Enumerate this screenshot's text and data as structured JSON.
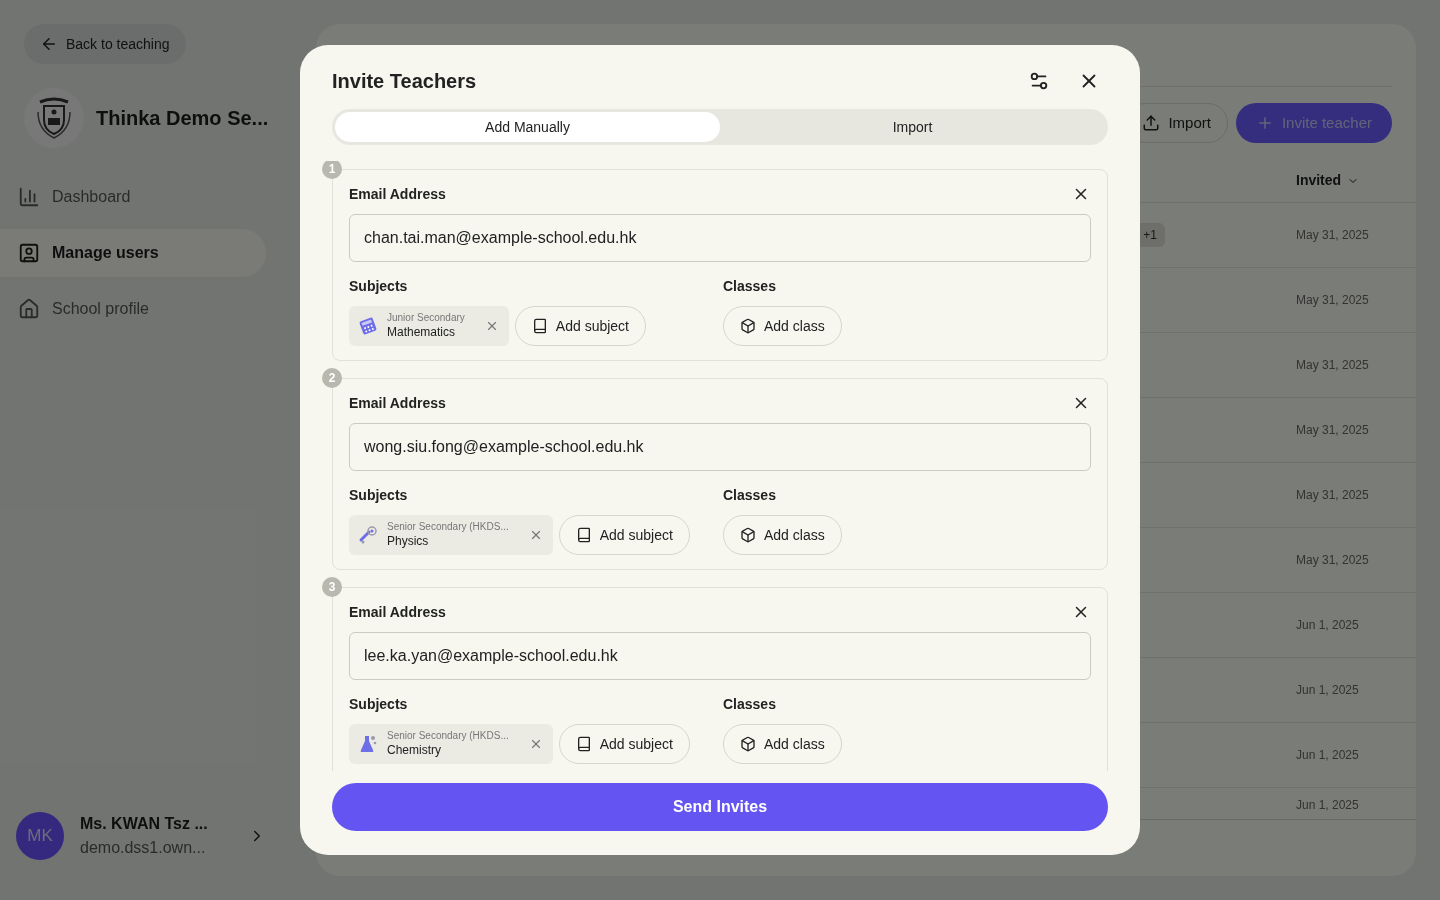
{
  "sidebar": {
    "back_button": "Back to teaching",
    "school_name": "Thinka Demo Se...",
    "nav": [
      {
        "label": "Dashboard",
        "kind": "chart",
        "selected": false
      },
      {
        "label": "Manage users",
        "kind": "user",
        "selected": true
      },
      {
        "label": "School profile",
        "kind": "home",
        "selected": false
      }
    ],
    "user": {
      "initials": "MK",
      "name": "Ms. KWAN Tsz ...",
      "email": "demo.dss1.own..."
    }
  },
  "main": {
    "buttons": [
      {
        "label": "Import",
        "kind": "outline"
      },
      {
        "label": "Invite teacher",
        "kind": "primary"
      }
    ],
    "table": {
      "columns": [
        "Invited"
      ],
      "rows": [
        {
          "badge": "+1",
          "invited": "May 31, 2025"
        },
        {
          "invited": "May 31, 2025"
        },
        {
          "invited": "May 31, 2025"
        },
        {
          "invited": "May 31, 2025"
        },
        {
          "invited": "May 31, 2025"
        },
        {
          "invited": "May 31, 2025"
        },
        {
          "invited": "Jun 1, 2025"
        },
        {
          "invited": "Jun 1, 2025"
        },
        {
          "invited": "Jun 1, 2025"
        },
        {
          "invited": "Jun 1, 2025"
        }
      ]
    }
  },
  "dialog": {
    "title": "Invite Teachers",
    "tabs": [
      {
        "label": "Add Manually",
        "selected": true
      },
      {
        "label": "Import",
        "selected": false
      }
    ],
    "entries": [
      {
        "number": "1",
        "email_label": "Email Address",
        "email": "chan.tai.man@example-school.edu.hk",
        "subjects_label": "Subjects",
        "subjects": [
          {
            "kind": "math",
            "level": "Junior Secondary",
            "name": "Mathematics"
          }
        ],
        "add_subject": "Add subject",
        "classes_label": "Classes",
        "add_class": "Add class"
      },
      {
        "number": "2",
        "email_label": "Email Address",
        "email": "wong.siu.fong@example-school.edu.hk",
        "subjects_label": "Subjects",
        "subjects": [
          {
            "kind": "physics",
            "level": "Senior Secondary (HKDS...",
            "name": "Physics"
          }
        ],
        "add_subject": "Add subject",
        "classes_label": "Classes",
        "add_class": "Add class"
      },
      {
        "number": "3",
        "email_label": "Email Address",
        "email": "lee.ka.yan@example-school.edu.hk",
        "subjects_label": "Subjects",
        "subjects": [
          {
            "kind": "chemistry",
            "level": "Senior Secondary (HKDS...",
            "name": "Chemistry"
          }
        ],
        "add_subject": "Add subject",
        "classes_label": "Classes",
        "add_class": "Add class"
      }
    ],
    "submit": "Send Invites"
  }
}
